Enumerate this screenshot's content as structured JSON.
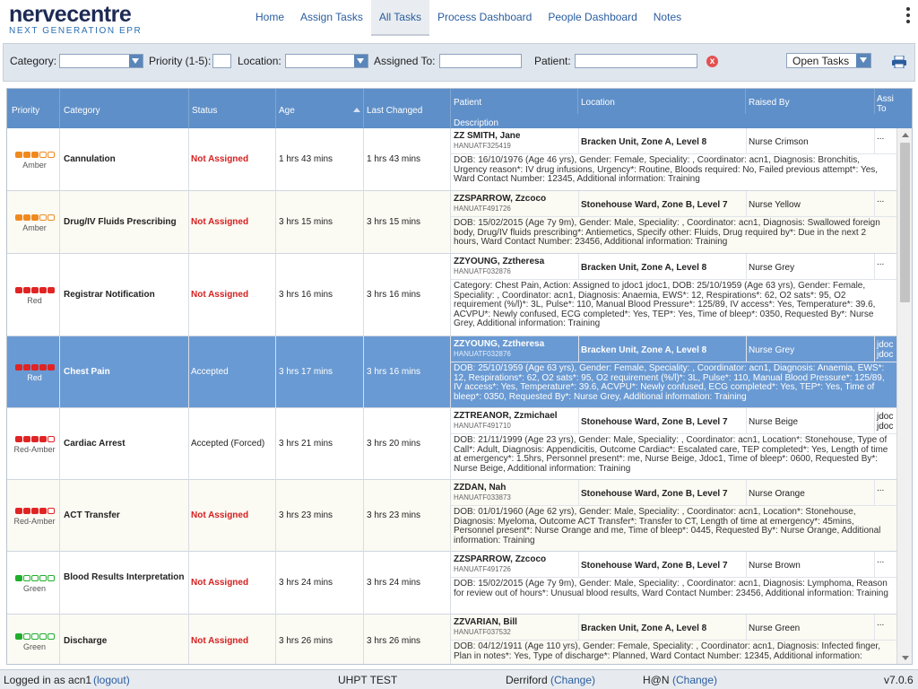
{
  "header": {
    "logo_main": "nervecentre",
    "logo_sub": "NEXT GENERATION EPR",
    "nav": [
      {
        "label": "Home"
      },
      {
        "label": "Assign Tasks"
      },
      {
        "label": "All Tasks",
        "active": true
      },
      {
        "label": "Process Dashboard"
      },
      {
        "label": "People Dashboard"
      },
      {
        "label": "Notes"
      }
    ]
  },
  "filters": {
    "category_label": "Category:",
    "priority_label": "Priority (1-5):",
    "location_label": "Location:",
    "assigned_label": "Assigned To:",
    "patient_label": "Patient:",
    "clear_icon": "x",
    "task_filter": "Open Tasks"
  },
  "columns": {
    "priority": "Priority",
    "category": "Category",
    "status": "Status",
    "age": "Age",
    "last_changed": "Last Changed",
    "patient": "Patient",
    "location": "Location",
    "raised_by": "Raised By",
    "assigned_to_1": "Assi",
    "assigned_to_2": "To",
    "description": "Description"
  },
  "colors": {
    "Amber": "#f08a1e",
    "Red": "#e02424",
    "Green": "#1fae2c"
  },
  "rows": [
    {
      "priority_label": "Amber",
      "color": "Amber",
      "filled": 3,
      "category": "Cannulation",
      "status": "Not Assigned",
      "age": "1 hrs 43 mins",
      "last_changed": "1 hrs 43 mins",
      "patient_name": "ZZ SMITH, Jane",
      "patient_id": "HANUATF325419",
      "location": "Bracken Unit, Zone A, Level 8",
      "raised_by": "Nurse Crimson",
      "assigned": "...",
      "assigned2": "",
      "description": "DOB: 16/10/1976 (Age 46 yrs), Gender: Female, Speciality: , Coordinator: acn1, Diagnosis: Bronchitis, Urgency reason*: IV drug infusions, Urgency*: Routine, Bloods required: No, Failed previous attempt*: Yes, Ward Contact Number: 12345, Additional information: Training"
    },
    {
      "priority_label": "Amber",
      "color": "Amber",
      "filled": 3,
      "category": "Drug/IV Fluids Prescribing",
      "status": "Not Assigned",
      "age": "3 hrs 15 mins",
      "last_changed": "3 hrs 15 mins",
      "patient_name": "ZZSPARROW, Zzcoco",
      "patient_id": "HANUATF491726",
      "location": "Stonehouse Ward, Zone B, Level 7",
      "raised_by": "Nurse Yellow",
      "assigned": "...",
      "assigned2": "",
      "description": "DOB: 15/02/2015 (Age 7y 9m), Gender: Male, Speciality: , Coordinator: acn1, Diagnosis: Swallowed foreign body, Drug/IV fluids prescribing*: Antiemetics, Specify other: Fluids, Drug required by*: Due in the next 2 hours, Ward Contact Number: 23456, Additional information: Training"
    },
    {
      "priority_label": "Red",
      "color": "Red",
      "filled": 5,
      "category": "Registrar Notification",
      "status": "Not Assigned",
      "age": "3 hrs 16 mins",
      "last_changed": "3 hrs 16 mins",
      "patient_name": "ZZYOUNG, Zztheresa",
      "patient_id": "HANUATF032876",
      "location": "Bracken Unit, Zone A, Level 8",
      "raised_by": "Nurse Grey",
      "assigned": "...",
      "assigned2": "",
      "description": "Category: Chest Pain, Action: Assigned to jdoc1 jdoc1, DOB: 25/10/1959 (Age 63 yrs), Gender: Female, Speciality: , Coordinator: acn1, Diagnosis: Anaemia, EWS*: 12, Respirations*: 62, O2 sats*: 95, O2 requirement (%/l)*: 3L, Pulse*: 110, Manual Blood Pressure*: 125/89, IV access*: Yes, Temperature*: 39.6, ACVPU*: Newly confused, ECG completed*: Yes, TEP*: Yes, Time of bleep*: 0350, Requested By*: Nurse Grey, Additional information: Training"
    },
    {
      "priority_label": "Red",
      "color": "Red",
      "filled": 5,
      "selected": true,
      "category": "Chest Pain",
      "status": "Accepted",
      "age": "3 hrs 17 mins",
      "last_changed": "3 hrs 16 mins",
      "patient_name": "ZZYOUNG, Zztheresa",
      "patient_id": "HANUATF032876",
      "location": "Bracken Unit, Zone A, Level 8",
      "raised_by": "Nurse Grey",
      "assigned": "jdoc",
      "assigned2": "jdoc",
      "description": "DOB: 25/10/1959 (Age 63 yrs), Gender: Female, Speciality: , Coordinator: acn1, Diagnosis: Anaemia, EWS*: 12, Respirations*: 62, O2 sats*: 95, O2 requirement (%/l)*: 3L, Pulse*: 110, Manual Blood Pressure*: 125/89, IV access*: Yes, Temperature*: 39.6, ACVPU*: Newly confused, ECG completed*: Yes, TEP*: Yes, Time of bleep*: 0350, Requested By*: Nurse Grey, Additional information: Training"
    },
    {
      "priority_label": "Red-Amber",
      "color": "Red",
      "filled": 4,
      "category": "Cardiac Arrest",
      "status": "Accepted (Forced)",
      "age": "3 hrs 21 mins",
      "last_changed": "3 hrs 20 mins",
      "patient_name": "ZZTREANOR, Zzmichael",
      "patient_id": "HANUATF491710",
      "location": "Stonehouse Ward, Zone B, Level 7",
      "raised_by": "Nurse Beige",
      "assigned": "jdoc",
      "assigned2": "jdoc",
      "description": "DOB: 21/11/1999 (Age 23 yrs), Gender: Male, Speciality: , Coordinator: acn1, Location*: Stonehouse, Type of Call*: Adult, Diagnosis: Appendicitis, Outcome Cardiac*: Escalated care, TEP completed*: Yes, Length of time at emergency*: 1.5hrs, Personnel present*: me, Nurse Beige, Jdoc1, Time of bleep*: 0600, Requested By*: Nurse Beige, Additional information: Training"
    },
    {
      "priority_label": "Red-Amber",
      "color": "Red",
      "filled": 4,
      "category": "ACT Transfer",
      "status": "Not Assigned",
      "age": "3 hrs 23 mins",
      "last_changed": "3 hrs 23 mins",
      "patient_name": "ZZDAN, Nah",
      "patient_id": "HANUATF033873",
      "location": "Stonehouse Ward, Zone B, Level 7",
      "raised_by": "Nurse Orange",
      "assigned": "...",
      "assigned2": "",
      "description": "DOB: 01/01/1960 (Age 62 yrs), Gender: Male, Speciality: , Coordinator: acn1, Location*: Stonehouse, Diagnosis: Myeloma, Outcome ACT Transfer*: Transfer to CT, Length of time at emergency*: 45mins, Personnel present*: Nurse Orange and me, Time of bleep*: 0445, Requested By*: Nurse Orange, Additional information: Training"
    },
    {
      "priority_label": "Green",
      "color": "Green",
      "filled": 1,
      "category": "Blood Results Interpretation",
      "status": "Not Assigned",
      "age": "3 hrs 24 mins",
      "last_changed": "3 hrs 24 mins",
      "patient_name": "ZZSPARROW, Zzcoco",
      "patient_id": "HANUATF491726",
      "location": "Stonehouse Ward, Zone B, Level 7",
      "raised_by": "Nurse Brown",
      "assigned": "...",
      "assigned2": "",
      "description": "DOB: 15/02/2015 (Age 7y 9m), Gender: Male, Speciality: , Coordinator: acn1, Diagnosis: Lymphoma, Reason for review out of hours*: Unusual blood results, Ward Contact Number: 23456, Additional information: Training"
    },
    {
      "priority_label": "Green",
      "color": "Green",
      "filled": 1,
      "category": "Discharge",
      "status": "Not Assigned",
      "age": "3 hrs 26 mins",
      "last_changed": "3 hrs 26 mins",
      "patient_name": "ZZVARIAN, Bill",
      "patient_id": "HANUATF037532",
      "location": "Bracken Unit, Zone A, Level 8",
      "raised_by": "Nurse Green",
      "assigned": "...",
      "assigned2": "",
      "description": "DOB: 04/12/1911 (Age 110 yrs), Gender: Female, Speciality: , Coordinator: acn1, Diagnosis: Infected finger, Plan in notes*: Yes, Type of discharge*: Planned, Ward Contact Number: 12345, Additional information:"
    }
  ],
  "footer": {
    "logged_in": "Logged in as acn1",
    "logout": "(logout)",
    "site": "UHPT TEST",
    "location": "Derriford",
    "change1": "(Change)",
    "team": "H@N",
    "change2": "(Change)",
    "version": "v7.0.6"
  }
}
